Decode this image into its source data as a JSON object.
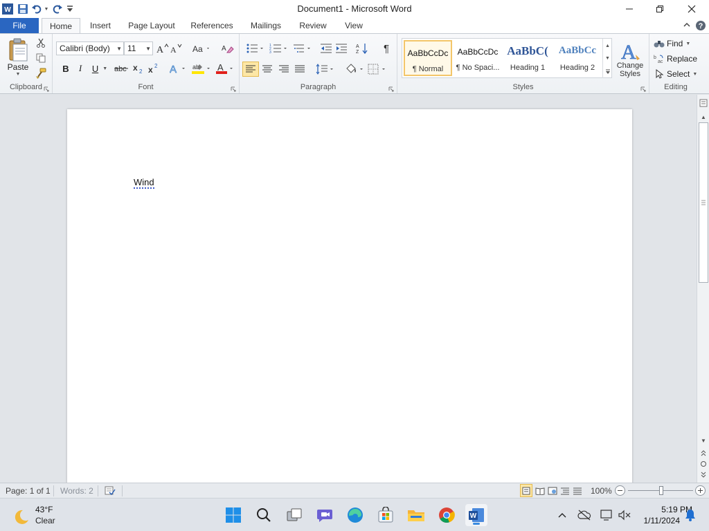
{
  "window": {
    "title": "Document1 - Microsoft Word"
  },
  "ribbon_tabs": {
    "file": "File",
    "tabs": [
      "Home",
      "Insert",
      "Page Layout",
      "References",
      "Mailings",
      "Review",
      "View"
    ],
    "active": "Home"
  },
  "clipboard": {
    "paste_label": "Paste",
    "group_label": "Clipboard"
  },
  "font": {
    "family": "Calibri (Body)",
    "size": "11",
    "group_label": "Font"
  },
  "paragraph": {
    "group_label": "Paragraph"
  },
  "styles": {
    "items": [
      {
        "sample": "AaBbCcDc",
        "name": "¶ Normal"
      },
      {
        "sample": "AaBbCcDc",
        "name": "¶ No Spaci..."
      },
      {
        "sample": "AaBbC(",
        "name": "Heading 1"
      },
      {
        "sample": "AaBbCc",
        "name": "Heading 2"
      }
    ],
    "change_styles_line1": "Change",
    "change_styles_line2": "Styles",
    "group_label": "Styles"
  },
  "editing": {
    "find": "Find",
    "replace": "Replace",
    "select": "Select",
    "group_label": "Editing"
  },
  "document": {
    "text": "Wind"
  },
  "statusbar": {
    "page": "Page: 1 of 1",
    "words": "Words: 2",
    "zoom": "100%"
  },
  "taskbar": {
    "weather_temp": "43°F",
    "weather_desc": "Clear",
    "time": "5:19 PM",
    "date": "1/11/2024"
  },
  "colors": {
    "file_tab": "#2a66c1",
    "accent": "#2b579a",
    "highlight": "#ffe600",
    "font_color": "#e0201b"
  }
}
